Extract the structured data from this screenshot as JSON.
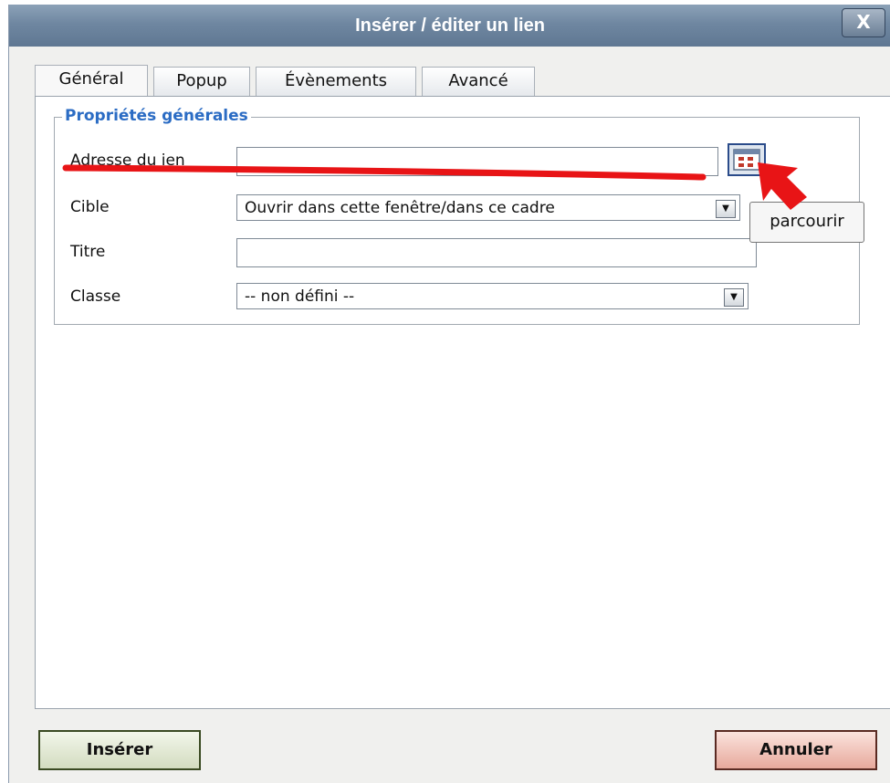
{
  "dialog": {
    "title": "Insérer / éditer un lien",
    "close_label": "X"
  },
  "tabs": [
    {
      "label": "Général",
      "active": true
    },
    {
      "label": "Popup",
      "active": false
    },
    {
      "label": "Évènements",
      "active": false
    },
    {
      "label": "Avancé",
      "active": false
    }
  ],
  "general": {
    "legend": "Propriétés générales",
    "link_address": {
      "label": "Adresse du ien",
      "value": ""
    },
    "target": {
      "label": "Cible",
      "selected": "Ouvrir dans cette fenêtre/dans ce cadre"
    },
    "title": {
      "label": "Titre",
      "value": ""
    },
    "class": {
      "label": "Classe",
      "selected": "-- non défini --"
    }
  },
  "browse_tooltip": "parcourir",
  "buttons": {
    "insert": "Insérer",
    "cancel": "Annuler"
  },
  "colors": {
    "accent": "#2b6cc4",
    "annotation": "#e81416",
    "insert_btn": "#e6ecd8",
    "cancel_btn": "#f2c7bd"
  }
}
